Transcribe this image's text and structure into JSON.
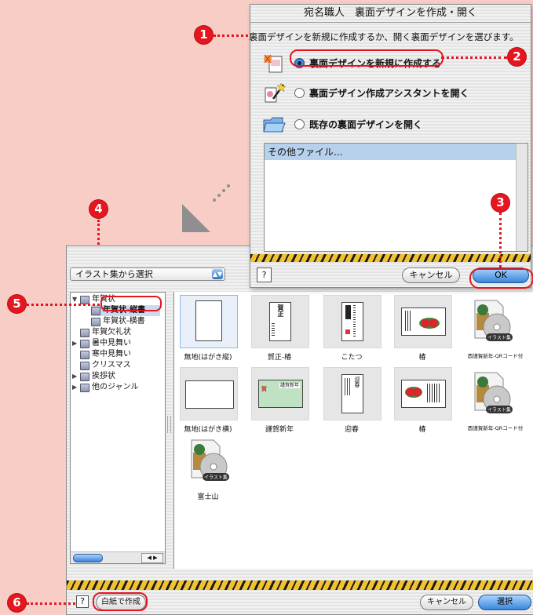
{
  "dialog1": {
    "title": "宛名職人　裏面デザインを作成・開く",
    "prompt": "裏面デザインを新規に作成するか、開く裏面デザインを選びます。",
    "options": [
      {
        "label": "裏面デザインを新規に作成する",
        "selected": true,
        "icon": "new-design-icon"
      },
      {
        "label": "裏面デザイン作成アシスタントを開く",
        "selected": false,
        "icon": "assistant-wand-icon"
      },
      {
        "label": "既存の裏面デザインを開く",
        "selected": false,
        "icon": "open-folder-icon"
      }
    ],
    "file_list": [
      "その他ファイル..."
    ],
    "help_label": "?",
    "cancel_label": "キャンセル",
    "ok_label": "OK"
  },
  "dialog2": {
    "source_popup": "イラスト集から選択",
    "tree": [
      {
        "label": "年賀状",
        "expanded": true,
        "level": 0
      },
      {
        "label": "年賀状-縦書",
        "level": 1,
        "selected": true
      },
      {
        "label": "年賀状-横書",
        "level": 1
      },
      {
        "label": "年賀欠礼状",
        "level": 0
      },
      {
        "label": "暑中見舞い",
        "level": 0,
        "expandable": true
      },
      {
        "label": "寒中見舞い",
        "level": 0
      },
      {
        "label": "クリスマス",
        "level": 0
      },
      {
        "label": "挨拶状",
        "level": 0,
        "expandable": true
      },
      {
        "label": "他のジャンル",
        "level": 0,
        "expandable": true
      }
    ],
    "thumbnails": [
      {
        "label": "無地(はがき縦)"
      },
      {
        "label": "賀正-椿"
      },
      {
        "label": "こたつ"
      },
      {
        "label": "椿"
      },
      {
        "label": "酉謹賀新年-QRコード付"
      },
      {
        "label": "無地(はがき横)"
      },
      {
        "label": "謹賀新年"
      },
      {
        "label": "迎春"
      },
      {
        "label": "椿"
      },
      {
        "label": "酉謹賀新年-QRコード付"
      },
      {
        "label": "富士山"
      }
    ],
    "thumb_texts": {
      "gashou": "賀正",
      "kinga": "謹賀新年",
      "kinga_card": "謹賀新年",
      "sanga": "賀",
      "geishun": "迎春",
      "cd_badge": "イラスト集"
    },
    "help_label": "?",
    "blank_button": "白紙で作成",
    "cancel_label": "キャンセル",
    "select_label": "選択"
  },
  "annotations": [
    "1",
    "2",
    "3",
    "4",
    "5",
    "6"
  ],
  "colors": {
    "annotation_red": "#e5161f",
    "background": "#f7cdc6",
    "accent_blue": "#3b86d8"
  }
}
